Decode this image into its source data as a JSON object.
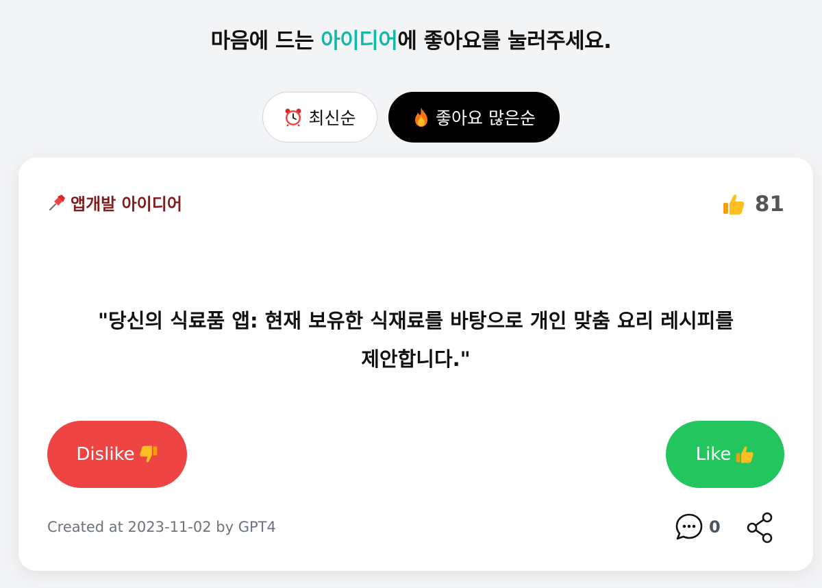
{
  "header": {
    "title_prefix": "마음에 드는 ",
    "title_accent": "아이디어",
    "title_suffix": "에 좋아요를 눌러주세요."
  },
  "sort": {
    "latest_label": "최신순",
    "latest_icon": "alarm-clock-icon",
    "popular_label": "좋아요 많은순",
    "popular_icon": "fire-icon",
    "active": "popular"
  },
  "idea": {
    "category": "앱개발 아이디어",
    "category_icon": "pushpin-icon",
    "likes": "81",
    "text": "\"당신의 식료품 앱: 현재 보유한 식재료를 바탕으로 개인 맞춤 요리 레시피를 제안합니다.\"",
    "dislike_label": "Dislike",
    "like_label": "Like",
    "created": "Created at 2023-11-02 by GPT4",
    "comments": "0"
  },
  "colors": {
    "accent": "#14b8a6",
    "dislike": "#ef4444",
    "like": "#22c55e",
    "category": "#7f1d1d"
  }
}
